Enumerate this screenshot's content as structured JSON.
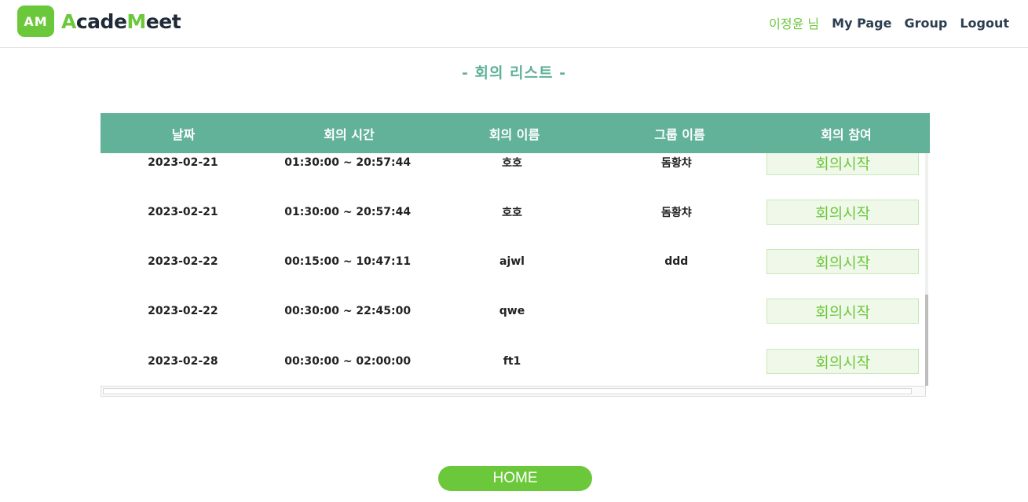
{
  "header": {
    "logo_badge": "AM",
    "logo_text_a": "A",
    "logo_text_b": "cade",
    "logo_text_c": "M",
    "logo_text_d": "eet",
    "user_label": "이정윤 님",
    "nav": {
      "my_page": "My Page",
      "group": "Group",
      "logout": "Logout"
    }
  },
  "page_title": "- 회의 리스트 -",
  "table": {
    "columns": [
      "날짜",
      "회의 시간",
      "회의 이름",
      "그룹 이름",
      "회의 참여"
    ],
    "rows": [
      {
        "date": "2023-02-21",
        "time": "01:30:00 ~ 20:57:44",
        "name": "호호",
        "group": "돔황챠",
        "action": "회의시작"
      },
      {
        "date": "2023-02-21",
        "time": "01:30:00 ~ 20:57:44",
        "name": "호호",
        "group": "돔황챠",
        "action": "회의시작"
      },
      {
        "date": "2023-02-22",
        "time": "00:15:00 ~ 10:47:11",
        "name": "ajwl",
        "group": "ddd",
        "action": "회의시작"
      },
      {
        "date": "2023-02-22",
        "time": "00:30:00 ~ 22:45:00",
        "name": "qwe",
        "group": "",
        "action": "회의시작"
      },
      {
        "date": "2023-02-28",
        "time": "00:30:00 ~ 02:00:00",
        "name": "ft1",
        "group": "",
        "action": "회의시작"
      }
    ]
  },
  "home_button": "HOME",
  "colors": {
    "accent": "#6bc83a",
    "table_header": "#62b299",
    "title": "#5fb199"
  }
}
